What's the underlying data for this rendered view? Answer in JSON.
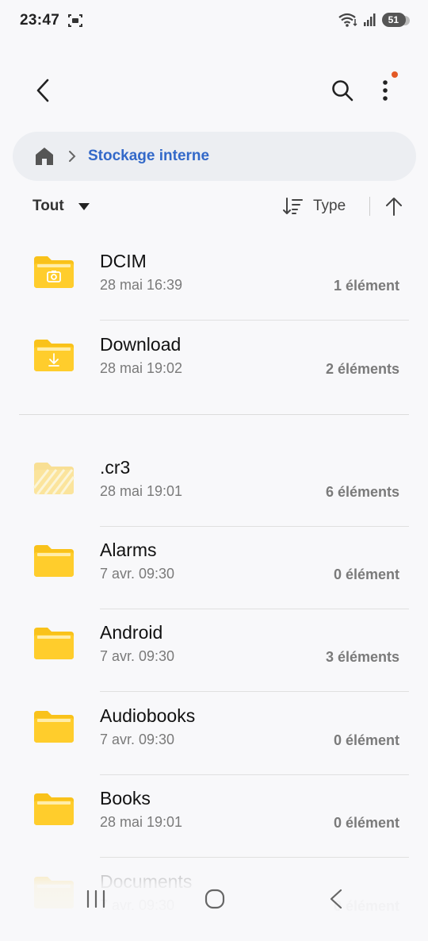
{
  "status": {
    "time": "23:47",
    "battery": "51"
  },
  "breadcrumb": {
    "current": "Stockage interne"
  },
  "sort": {
    "filter_label": "Tout",
    "sort_label": "Type"
  },
  "folders": [
    {
      "name": "DCIM",
      "date": "28 mai 16:39",
      "count": "1 élément",
      "icon": "camera-folder-icon"
    },
    {
      "name": "Download",
      "date": "28 mai 19:02",
      "count": "2 éléments",
      "icon": "download-folder-icon"
    },
    {
      "name": ".cr3",
      "date": "28 mai 19:01",
      "count": "6 éléments",
      "icon": "hidden-folder-icon"
    },
    {
      "name": "Alarms",
      "date": "7 avr. 09:30",
      "count": "0 élément",
      "icon": "folder-icon"
    },
    {
      "name": "Android",
      "date": "7 avr. 09:30",
      "count": "3 éléments",
      "icon": "folder-icon"
    },
    {
      "name": "Audiobooks",
      "date": "7 avr. 09:30",
      "count": "0 élément",
      "icon": "folder-icon"
    },
    {
      "name": "Books",
      "date": "28 mai 19:01",
      "count": "0 élément",
      "icon": "folder-icon"
    },
    {
      "name": "Documents",
      "date": "7 avr. 09:30",
      "count": "0 élément",
      "icon": "folder-icon"
    }
  ],
  "colors": {
    "accent": "#3369c9",
    "folder": "#f9c21a",
    "notification_dot": "#e35a26"
  }
}
